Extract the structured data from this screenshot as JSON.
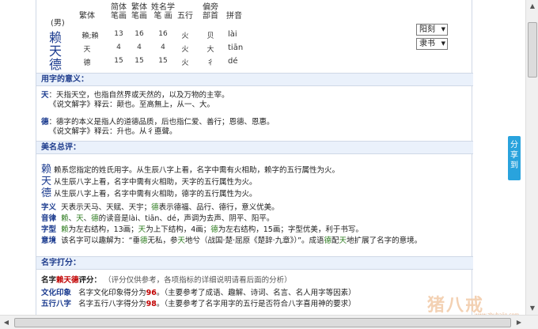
{
  "header": {
    "gender": "(男)",
    "columns": [
      {
        "top": "",
        "bottom": "繁体"
      },
      {
        "top": "简体",
        "bottom": "笔画"
      },
      {
        "top": "繁体",
        "bottom": "笔画"
      },
      {
        "top": "姓名学",
        "bottom": "笔  画"
      },
      {
        "top": "",
        "bottom": "五行"
      },
      {
        "top": "偏旁",
        "bottom": "部首"
      },
      {
        "top": "",
        "bottom": "拼音"
      }
    ],
    "rows": [
      {
        "char": "赖",
        "trad": "賴;賴",
        "simp": "13",
        "tradstroke": "16",
        "xm": "16",
        "wx": "火",
        "radical": "贝",
        "pinyin": "lài"
      },
      {
        "char": "天",
        "trad": "天",
        "simp": "4",
        "tradstroke": "4",
        "xm": "4",
        "wx": "火",
        "radical": "大",
        "pinyin": "tiān"
      },
      {
        "char": "德",
        "trad": "德",
        "simp": "15",
        "tradstroke": "15",
        "xm": "15",
        "wx": "火",
        "radical": "彳",
        "pinyin": "dé"
      }
    ]
  },
  "selects": {
    "style": "阳刻",
    "font": "隶书"
  },
  "section1": {
    "title": "用字的意义：",
    "p1_char": "天",
    "p1_text": "：天指天空，也指自然界或天然的，以及万物的主宰。",
    "p1_quote": "《说文解字》释云：颠也。至高無上，从一、大。",
    "p2_char": "德",
    "p2_text": "：德字的本义是指人的道德品质，后也指仁爱、善行；恩德、恩惠。",
    "p2_quote": "《说文解字》释云：升也。从彳悳聲。"
  },
  "section2": {
    "title": "美名总评：",
    "lines": [
      {
        "char": "赖",
        "text": "赖系您指定的姓氏用字。从生辰八字上看，名字中需有火相助，赖字的五行属性为火。"
      },
      {
        "char": "天",
        "text": "从生辰八字上看，名字中需有火相助，天字的五行属性为火。"
      },
      {
        "char": "德",
        "text": "从生辰八字上看，名字中需有火相助，德字的五行属性为火。"
      }
    ],
    "zi_yi_label": "字义",
    "zi_yi_p1": "天表示天马、天赋、天宇；",
    "zi_yi_hl": "德",
    "zi_yi_p2": "表示德福、品行、德行，意义优美。",
    "yin_lv_label": "音律",
    "yin_lv_c1": "赖",
    "yin_lv_c2": "天",
    "yin_lv_c3": "德",
    "yin_lv_text": "的读音是lài、tiān、dé，声调为去声、阴平、阳平。",
    "zi_xing_label": "字型",
    "zi_xing_c1": "赖",
    "zi_xing_t1": "为左右结构，13画；",
    "zi_xing_c2": "天",
    "zi_xing_t2": "为上下结构，4画；",
    "zi_xing_c3": "德",
    "zi_xing_t3": "为左右结构，15画；字型优美，利于书写。",
    "yi_jing_label": "意境",
    "yi_jing_p1": "该名字可以趣解为：“垂",
    "yi_jing_c1": "德",
    "yi_jing_p2": "无私，参",
    "yi_jing_c2": "天",
    "yi_jing_p3": "地兮（战国·楚·屈原《楚辞·九章》）”。成语",
    "yi_jing_c3": "德",
    "yi_jing_p4": "配",
    "yi_jing_c4": "天",
    "yi_jing_p5": "地扩展了名字的意境。"
  },
  "section3": {
    "title": "名字打分：",
    "score_label1": "名字",
    "score_name": "赖天德",
    "score_label2": "评分：",
    "score_note": "（评分仅供参考，各项指标的详细说明请看后面的分析）",
    "culture_label": "文化印象",
    "culture_text1": "名字文化印象得分为",
    "culture_score": "96",
    "culture_text2": "。（主要参考了成语、趣解、诗词、名言、名人用字等因素）",
    "wx_label": "五行八字",
    "wx_text1": "名字五行八字得分为",
    "wx_score": "98",
    "wx_text2": "。（主要参考了名字用字的五行是否符合八字喜用神的要求）"
  },
  "share": {
    "label": "分享到"
  },
  "watermark": {
    "text": "猪八戒",
    "sub": "www.zhubajie.com"
  },
  "colors": {
    "accent": "#1b3b8f",
    "highlight": "#c00000",
    "green": "#2b7a1d",
    "share": "#29a3dd"
  }
}
